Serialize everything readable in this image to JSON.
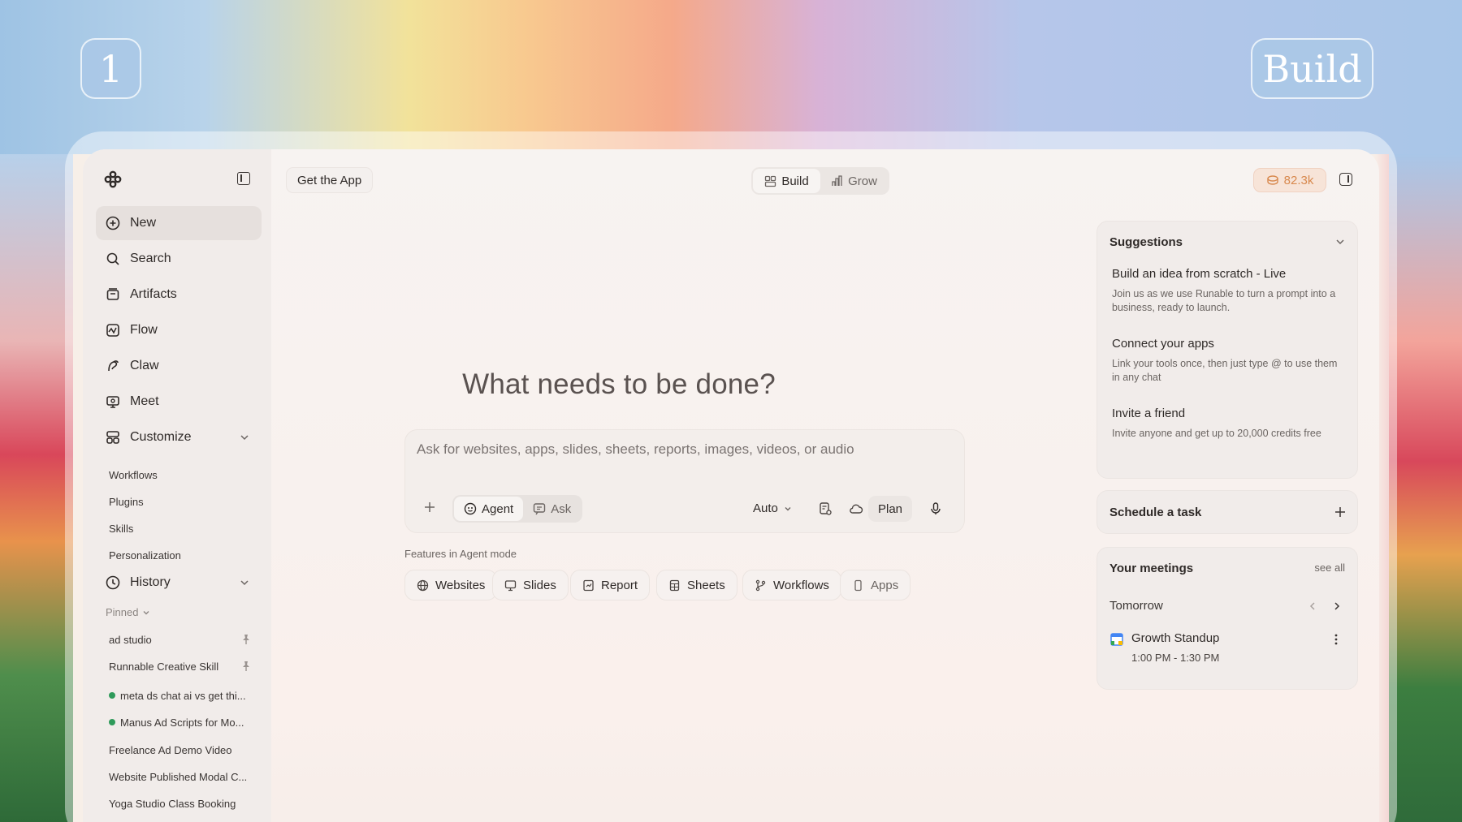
{
  "step_badge": "1",
  "mode_badge": "Build",
  "header": {
    "get_app_label": "Get the App",
    "tabs": [
      {
        "label": "Build",
        "icon": "build-icon",
        "active": true
      },
      {
        "label": "Grow",
        "icon": "chart-icon",
        "active": false
      }
    ],
    "credits": "82.3k"
  },
  "sidebar": {
    "nav": [
      {
        "label": "New",
        "icon": "plus-circle-icon",
        "active": true
      },
      {
        "label": "Search",
        "icon": "search-icon"
      },
      {
        "label": "Artifacts",
        "icon": "archive-icon"
      },
      {
        "label": "Flow",
        "icon": "flow-icon"
      },
      {
        "label": "Claw",
        "icon": "claw-icon"
      },
      {
        "label": "Meet",
        "icon": "meet-icon"
      },
      {
        "label": "Customize",
        "icon": "customize-icon"
      }
    ],
    "customize_items": [
      "Workflows",
      "Plugins",
      "Skills",
      "Personalization"
    ],
    "history_label": "History",
    "pinned_label": "Pinned",
    "history_items": [
      {
        "label": "ad studio",
        "pinned": true,
        "dot": false
      },
      {
        "label": "Runnable Creative Skill",
        "pinned": true,
        "dot": false
      },
      {
        "label": "meta ds chat ai vs get thi...",
        "pinned": false,
        "dot": true
      },
      {
        "label": "Manus Ad Scripts for Mo...",
        "pinned": false,
        "dot": true
      },
      {
        "label": "Freelance Ad Demo Video",
        "pinned": false,
        "dot": false
      },
      {
        "label": "Website Published Modal C...",
        "pinned": false,
        "dot": false
      },
      {
        "label": "Yoga Studio Class Booking",
        "pinned": false,
        "dot": false
      }
    ]
  },
  "main": {
    "headline": "What needs to be done?",
    "composer": {
      "placeholder": "Ask for websites, apps, slides, sheets, reports, images, videos, or audio",
      "modes": [
        "Agent",
        "Ask"
      ],
      "model": "Auto",
      "plan_label": "Plan"
    },
    "features_label": "Features in Agent mode",
    "features": [
      "Websites",
      "Slides",
      "Report",
      "Sheets",
      "Workflows",
      "Apps"
    ]
  },
  "right_panel": {
    "suggestions_title": "Suggestions",
    "suggestions": [
      {
        "title": "Build an idea from scratch - Live",
        "desc": "Join us as we use Runable to turn a prompt into a business, ready to launch."
      },
      {
        "title": "Connect your apps",
        "desc": "Link your tools once, then just type @ to use them in any chat"
      },
      {
        "title": "Invite a friend",
        "desc": "Invite anyone and get up to 20,000 credits free"
      }
    ],
    "schedule_title": "Schedule a task",
    "meetings_title": "Your meetings",
    "see_all": "see all",
    "day_label": "Tomorrow",
    "meeting": {
      "title": "Growth Standup",
      "time": "1:00 PM - 1:30 PM"
    }
  },
  "colors": {
    "accent_credits": "#d8894e",
    "status_dot": "#2f9a5a"
  }
}
